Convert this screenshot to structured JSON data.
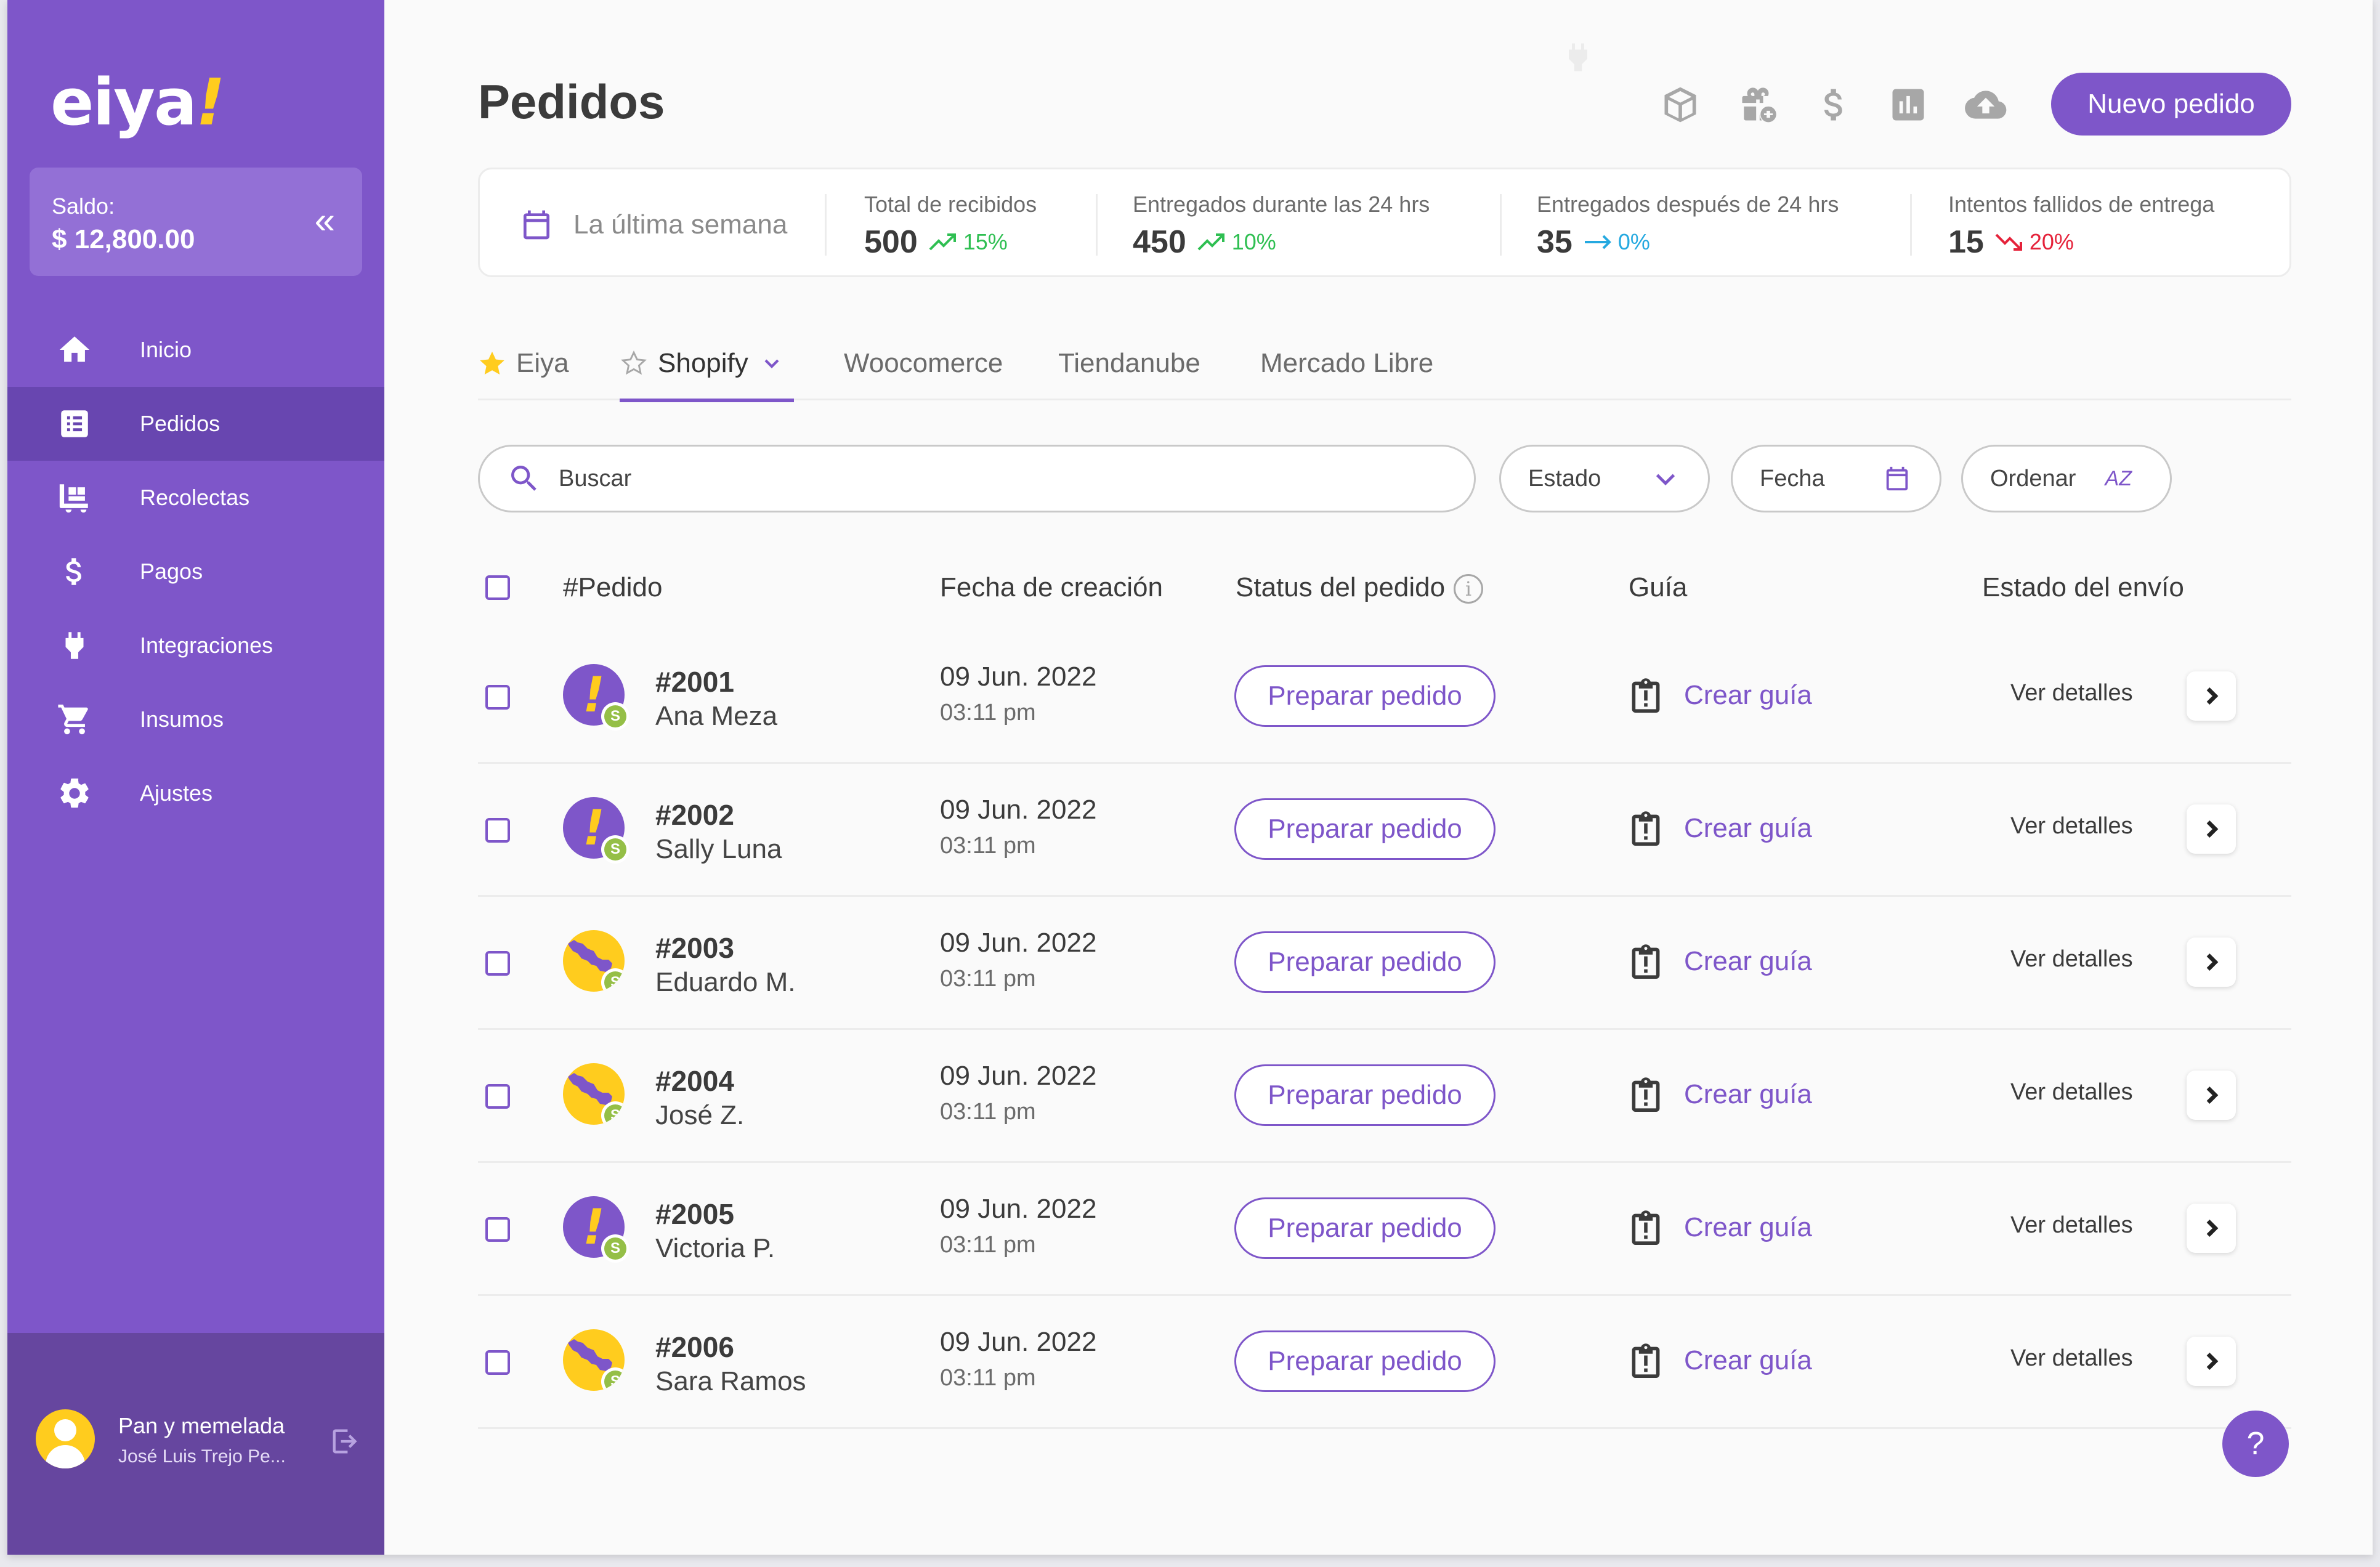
{
  "sidebar": {
    "logo": "eiya",
    "logo_mark": "!",
    "balance_label": "Saldo:",
    "balance_amount": "$ 12,800.00",
    "collapse_icon": "double-chevron-left-icon",
    "items": [
      {
        "label": "Inicio",
        "icon": "home-icon",
        "active": false
      },
      {
        "label": "Pedidos",
        "icon": "list-icon",
        "active": true
      },
      {
        "label": "Recolectas",
        "icon": "cart-truck-icon",
        "active": false
      },
      {
        "label": "Pagos",
        "icon": "dollar-icon",
        "active": false
      },
      {
        "label": "Integraciones",
        "icon": "plug-icon",
        "active": false
      },
      {
        "label": "Insumos",
        "icon": "shopping-cart-icon",
        "active": false
      },
      {
        "label": "Ajustes",
        "icon": "gear-icon",
        "active": false
      }
    ],
    "user": {
      "name": "Pan y memelada",
      "subtitle": "José Luis Trejo Pe..."
    }
  },
  "header": {
    "title": "Pedidos",
    "icons": [
      "package-icon",
      "gift-add-icon",
      "dollar-icon",
      "bar-chart-icon",
      "cloud-upload-icon"
    ],
    "new_order_label": "Nuevo pedido"
  },
  "stats": {
    "range_label": "La última semana",
    "items": [
      {
        "title": "Total de recibidos",
        "value": "500",
        "trend": "15%",
        "direction": "up"
      },
      {
        "title": "Entregados durante las 24 hrs",
        "value": "450",
        "trend": "10%",
        "direction": "up"
      },
      {
        "title": "Entregados después de 24 hrs",
        "value": "35",
        "trend": "0%",
        "direction": "flat"
      },
      {
        "title": "Intentos fallidos de entrega",
        "value": "15",
        "trend": "20%",
        "direction": "down"
      }
    ],
    "colors": {
      "up": "#2fbf52",
      "flat": "#25a9e0",
      "down": "#e5223a"
    }
  },
  "tabs": [
    {
      "label": "Eiya",
      "starred": true
    },
    {
      "label": "Shopify",
      "starred": false,
      "active": true
    },
    {
      "label": "Woocomerce"
    },
    {
      "label": "Tiendanube"
    },
    {
      "label": "Mercado Libre"
    }
  ],
  "filters": {
    "search_placeholder": "Buscar",
    "estado": "Estado",
    "fecha": "Fecha",
    "ordenar": "Ordenar",
    "sort_glyph": "AZ"
  },
  "table": {
    "headers": {
      "order": "#Pedido",
      "created": "Fecha de creación",
      "status": "Status del pedido",
      "guide": "Guía",
      "shipping": "Estado del envío"
    },
    "rows": [
      {
        "number": "#2001",
        "customer": "Ana Meza",
        "date": "09 Jun. 2022",
        "time": "03:11 pm",
        "status_button": "Preparar pedido",
        "guide_link": "Crear guía",
        "details": "Ver detalles",
        "badge": "alert"
      },
      {
        "number": "#2002",
        "customer": "Sally Luna",
        "date": "09 Jun. 2022",
        "time": "03:11 pm",
        "status_button": "Preparar pedido",
        "guide_link": "Crear guía",
        "details": "Ver detalles",
        "badge": "alert"
      },
      {
        "number": "#2003",
        "customer": "Eduardo M.",
        "date": "09 Jun. 2022",
        "time": "03:11 pm",
        "status_button": "Preparar pedido",
        "guide_link": "Crear guía",
        "details": "Ver detalles",
        "badge": "map"
      },
      {
        "number": "#2004",
        "customer": "José Z.",
        "date": "09 Jun. 2022",
        "time": "03:11 pm",
        "status_button": "Preparar pedido",
        "guide_link": "Crear guía",
        "details": "Ver detalles",
        "badge": "map"
      },
      {
        "number": "#2005",
        "customer": "Victoria P.",
        "date": "09 Jun. 2022",
        "time": "03:11 pm",
        "status_button": "Preparar pedido",
        "guide_link": "Crear guía",
        "details": "Ver detalles",
        "badge": "alert"
      },
      {
        "number": "#2006",
        "customer": "Sara Ramos",
        "date": "09 Jun. 2022",
        "time": "03:11 pm",
        "status_button": "Preparar pedido",
        "guide_link": "Crear guía",
        "details": "Ver detalles",
        "badge": "map"
      }
    ],
    "shop_badge_glyph": "S"
  },
  "help_label": "?",
  "colors": {
    "brand": "#7e56c9",
    "brand_dark": "#6846b0",
    "accent_yellow": "#ffcc1e",
    "shopify_green": "#95bf47"
  }
}
